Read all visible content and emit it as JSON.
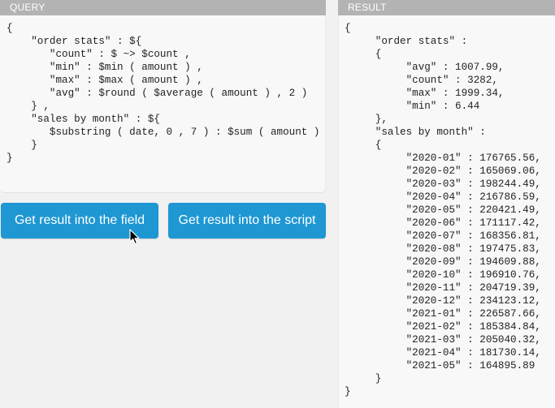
{
  "query_panel": {
    "title": "QUERY",
    "code": "{\n    \"order stats\" : ${\n       \"count\" : $ ~> $count ,\n       \"min\" : $min ( amount ) ,\n       \"max\" : $max ( amount ) ,\n       \"avg\" : $round ( $average ( amount ) , 2 )\n    } ,\n    \"sales by month\" : ${\n       $substring ( date, 0 , 7 ) : $sum ( amount )\n    }\n}"
  },
  "result_panel": {
    "title": "RESULT",
    "code": "{\n     \"order stats\" :\n     {\n          \"avg\" : 1007.99,\n          \"count\" : 3282,\n          \"max\" : 1999.34,\n          \"min\" : 6.44\n     },\n     \"sales by month\" :\n     {\n          \"2020-01\" : 176765.56,\n          \"2020-02\" : 165069.06,\n          \"2020-03\" : 198244.49,\n          \"2020-04\" : 216786.59,\n          \"2020-05\" : 220421.49,\n          \"2020-06\" : 171117.42,\n          \"2020-07\" : 168356.81,\n          \"2020-08\" : 197475.83,\n          \"2020-09\" : 194609.88,\n          \"2020-10\" : 196910.76,\n          \"2020-11\" : 204719.39,\n          \"2020-12\" : 234123.12,\n          \"2021-01\" : 226587.66,\n          \"2021-02\" : 185384.84,\n          \"2021-03\" : 205040.32,\n          \"2021-04\" : 181730.14,\n          \"2021-05\" : 164895.89\n     }\n}"
  },
  "buttons": {
    "result_to_field": "Get result into the field",
    "result_to_script": "Get result into the script"
  },
  "colors": {
    "button_bg": "#1e97d3",
    "header_bg": "#b3b3b3",
    "panel_bg": "#f8f8f8",
    "page_bg": "#f1f1f1"
  },
  "cursor": {
    "icon": "arrow-pointer-icon"
  }
}
